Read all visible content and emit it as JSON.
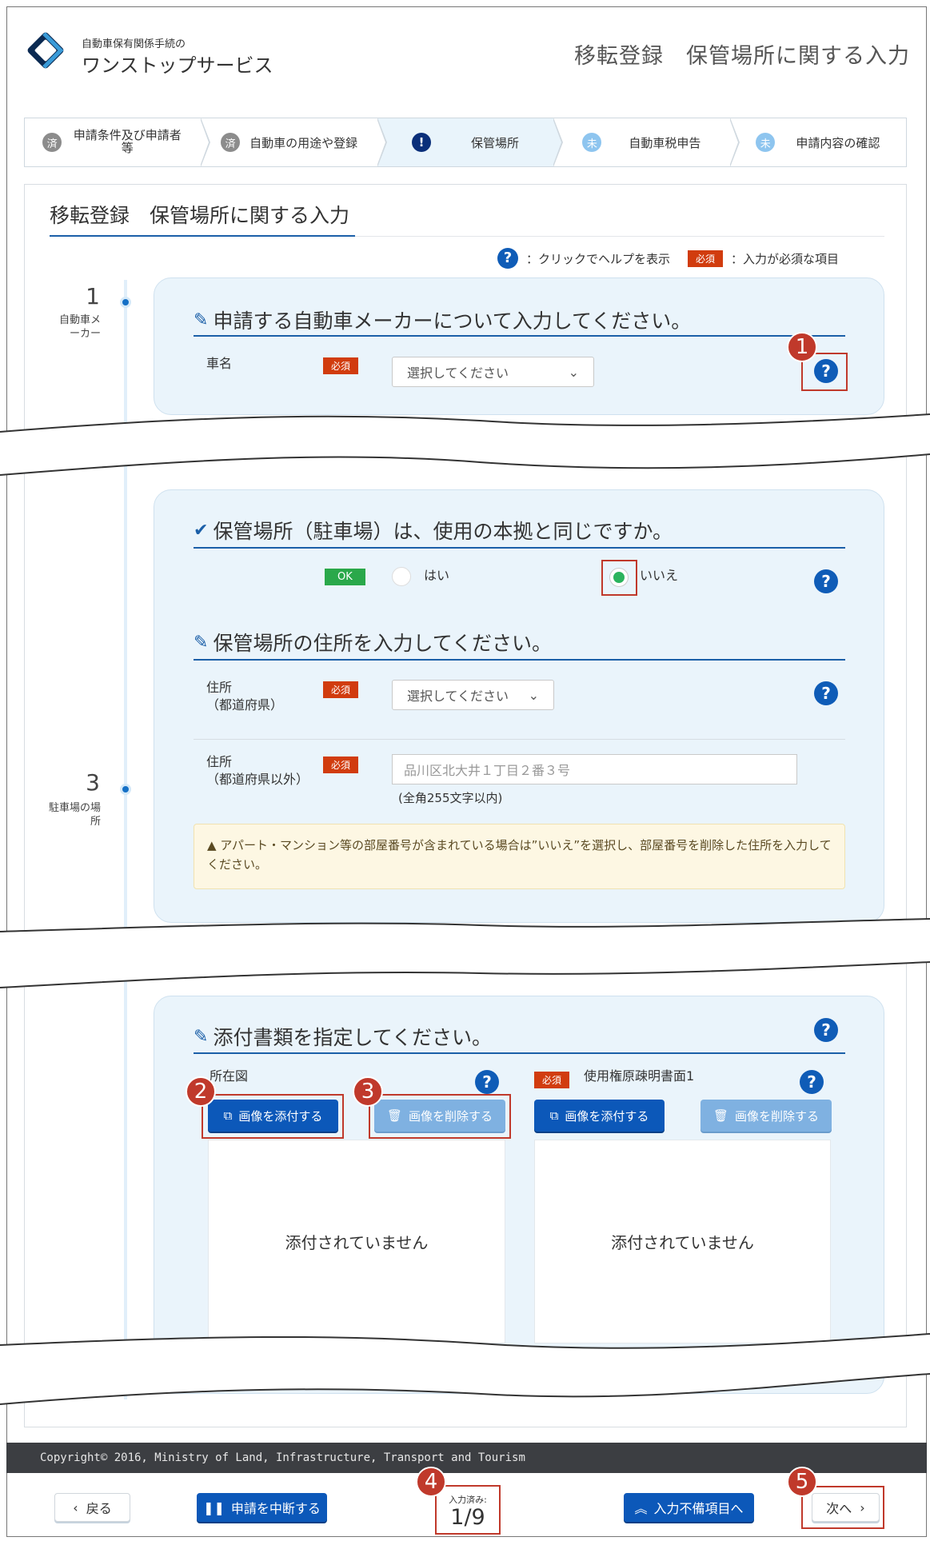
{
  "header": {
    "logo_sub": "自動車保有関係手続の",
    "logo_main": "ワンストップサービス",
    "page_title": "移転登録　保管場所に関する入力"
  },
  "stepper": {
    "steps": [
      {
        "icon": "済",
        "label": "申請条件及び申請者等",
        "state": "done"
      },
      {
        "icon": "済",
        "label": "自動車の用途や登録",
        "state": "done"
      },
      {
        "icon": "!",
        "label": "保管場所",
        "state": "current"
      },
      {
        "icon": "未",
        "label": "自動車税申告",
        "state": "todo"
      },
      {
        "icon": "未",
        "label": "申請内容の確認",
        "state": "todo"
      }
    ]
  },
  "main": {
    "title": "移転登録　保管場所に関する入力",
    "legend_help": "：クリックでヘルプを表示",
    "legend_required": "必須",
    "legend_required_text": "：入力が必須な項目"
  },
  "section1": {
    "number": "1",
    "label": "自動車メーカー",
    "heading": "申請する自動車メーカーについて入力してください。",
    "car_name_label": "車名",
    "required": "必須",
    "car_select_value": "選択してください",
    "badge": "1"
  },
  "section3": {
    "number": "3",
    "label": "駐車場の場所",
    "q_heading": "保管場所（駐車場）は、使用の本拠と同じですか。",
    "ok": "OK",
    "yes": "はい",
    "no": "いいえ",
    "selected": "いいえ",
    "addr_heading": "保管場所の住所を入力してください。",
    "pref_label_1": "住所",
    "pref_label_2": "（都道府県）",
    "pref_select_value": "選択してください",
    "addr_label_1": "住所",
    "addr_label_2": "（都道府県以外）",
    "addr_placeholder": "品川区北大井１丁目２番３号",
    "addr_hint": "(全角255文字以内)",
    "warning": "アパート・マンション等の部屋番号が含まれている場合は”いいえ”を選択し、部屋番号を削除した住所を入力してください。",
    "required": "必須"
  },
  "attachments": {
    "heading": "添付書類を指定してください。",
    "doc1_label": "所在図",
    "doc2_required": "必須",
    "doc2_label": "使用権原疎明書面1",
    "attach_btn": "画像を添付する",
    "delete_btn": "画像を削除する",
    "empty_text": "添付されていません",
    "badge2": "2",
    "badge3": "3"
  },
  "footer": {
    "copyright": "Copyright© 2016, Ministry of Land, Infrastructure, Transport and Tourism",
    "back": "戻る",
    "suspend": "申請を中断する",
    "counter_label": "入力済み:",
    "counter_value": "1/9",
    "incomplete": "入力不備項目へ",
    "next": "次へ",
    "badge4": "4",
    "badge5": "5"
  },
  "colors": {
    "accent": "#0c58b9",
    "required": "#d13c0e",
    "highlight": "#c0392b",
    "panel": "#eaf4fb"
  }
}
